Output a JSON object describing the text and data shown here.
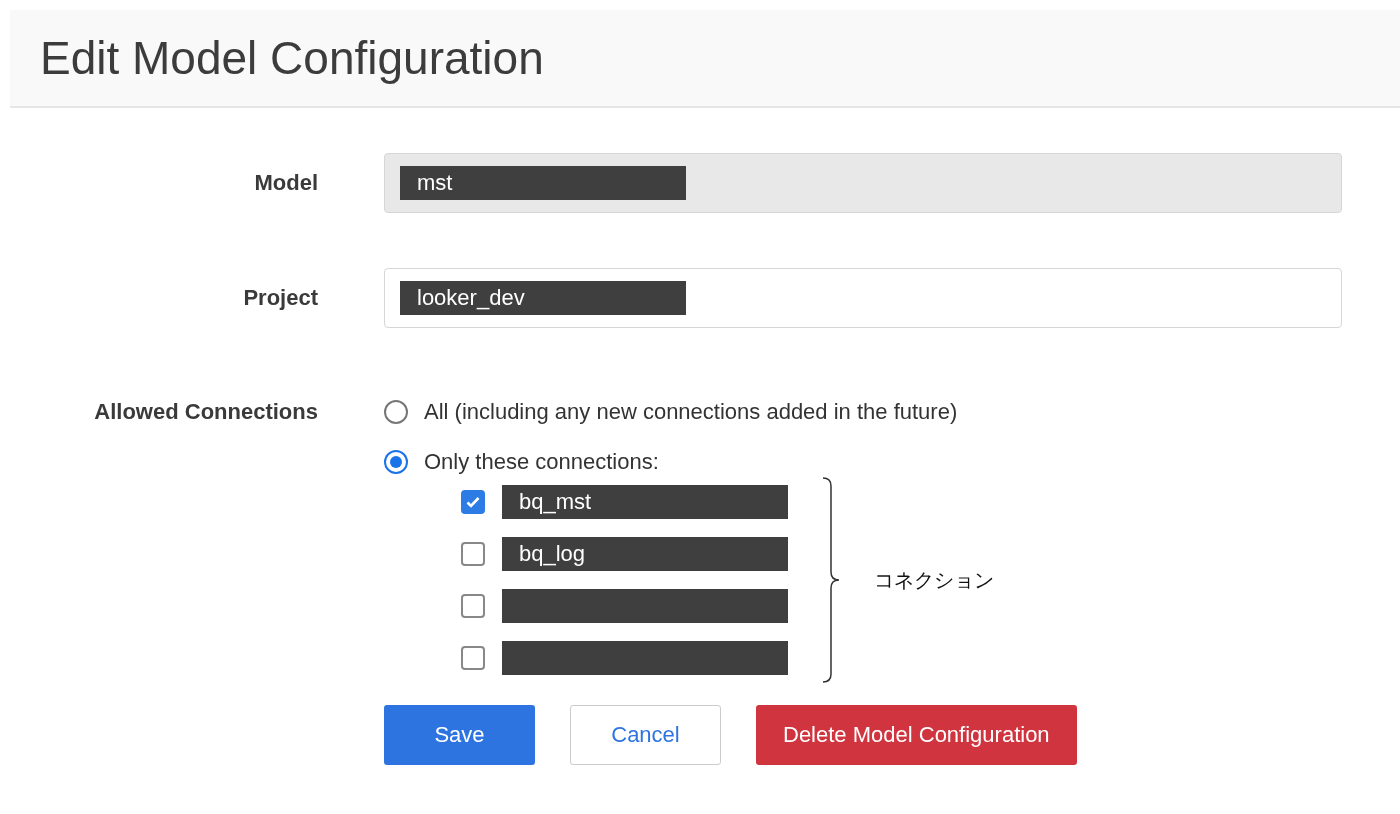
{
  "header": {
    "title": "Edit Model Configuration"
  },
  "fields": [
    {
      "label": "Model",
      "value": "mst",
      "disabled": true
    },
    {
      "label": "Project",
      "value": "looker_dev",
      "disabled": false
    }
  ],
  "allowed_connections": {
    "label": "Allowed Connections",
    "options": [
      {
        "label": "All (including any new connections added in the future)",
        "selected": false
      },
      {
        "label": "Only these connections:",
        "selected": true
      }
    ],
    "connections": [
      {
        "name": "bq_mst",
        "checked": true
      },
      {
        "name": "bq_log",
        "checked": false
      },
      {
        "checked": false
      },
      {
        "checked": false
      }
    ]
  },
  "annotation": {
    "label": "コネクション"
  },
  "buttons": [
    {
      "label": "Save",
      "kind": "primary"
    },
    {
      "label": "Cancel",
      "kind": "secondary"
    },
    {
      "label": "Delete Model Configuration",
      "kind": "danger"
    }
  ]
}
